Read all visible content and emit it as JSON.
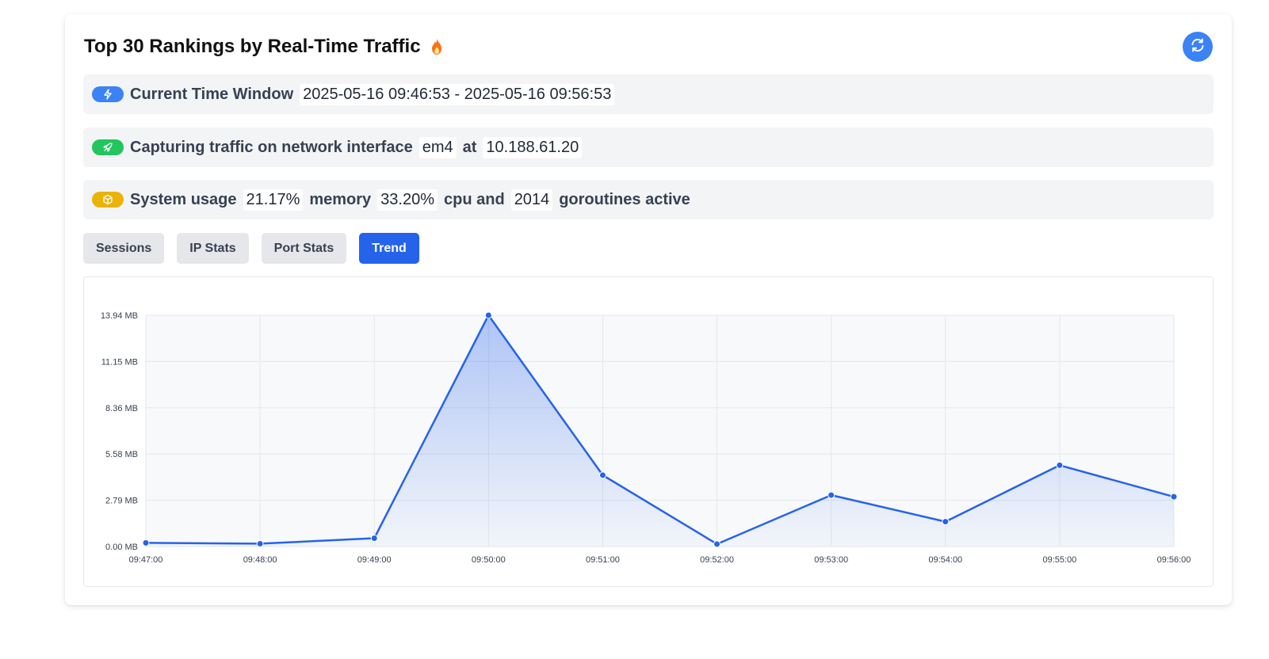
{
  "header": {
    "title": "Top 30 Rankings by Real-Time Traffic",
    "title_icon": "flame-icon",
    "refresh_icon": "refresh-icon"
  },
  "info": {
    "time_window": {
      "icon": "lightning-icon",
      "color": "#3b82f6",
      "label": "Current Time Window",
      "value": "2025-05-16 09:46:53 - 2025-05-16 09:56:53"
    },
    "capture": {
      "icon": "rocket-icon",
      "color": "#22c55e",
      "label": "Capturing traffic on network interface",
      "interface": "em4",
      "at_label": "at",
      "ip": "10.188.61.20"
    },
    "system": {
      "icon": "cube-icon",
      "color": "#eab308",
      "label": "System usage",
      "memory_value": "21.17%",
      "memory_label": "memory",
      "cpu_value": "33.20%",
      "cpu_label": "cpu and",
      "goroutines_value": "2014",
      "goroutines_label": "goroutines active"
    }
  },
  "tabs": [
    {
      "label": "Sessions",
      "active": false
    },
    {
      "label": "IP Stats",
      "active": false
    },
    {
      "label": "Port Stats",
      "active": false
    },
    {
      "label": "Trend",
      "active": true
    }
  ],
  "colors": {
    "accent": "#2563eb",
    "line": "#2563eb"
  },
  "chart_data": {
    "type": "area",
    "x": [
      "09:47:00",
      "09:48:00",
      "09:49:00",
      "09:50:00",
      "09:51:00",
      "09:52:00",
      "09:53:00",
      "09:54:00",
      "09:55:00",
      "09:56:00"
    ],
    "series": [
      {
        "values": [
          0.22,
          0.17,
          0.5,
          13.94,
          4.3,
          0.15,
          3.1,
          1.5,
          4.9,
          3.0
        ]
      }
    ],
    "y_ticks": [
      "0.00 MB",
      "2.79 MB",
      "5.58 MB",
      "8.36 MB",
      "11.15 MB",
      "13.94 MB"
    ],
    "ylim": [
      0,
      13.94
    ],
    "grid": true,
    "title": "",
    "xlabel": "",
    "ylabel": ""
  }
}
